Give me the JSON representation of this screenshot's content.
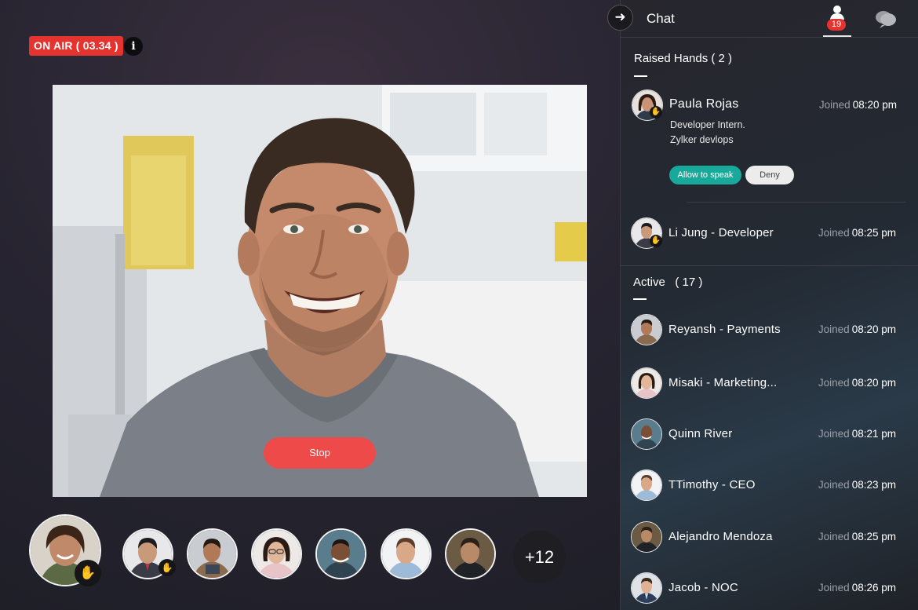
{
  "stage": {
    "on_air_label": "ON AIR ( 03.34 )",
    "info_label": "i",
    "stop_label": "Stop",
    "more_participants": "+12"
  },
  "panel": {
    "title": "Chat",
    "people_count": "19",
    "raised_hands": {
      "title": "Raised Hands ( 2 )",
      "people": [
        {
          "name": "Paula Rojas",
          "joined_label": "Joined",
          "joined_time": "08:20 pm",
          "role": "Developer Intern.",
          "company": "Zylker devlops",
          "allow_label": "Allow to speak",
          "deny_label": "Deny"
        },
        {
          "name": "Li Jung - Developer",
          "joined_label": "Joined",
          "joined_time": "08:25 pm"
        }
      ]
    },
    "active": {
      "title": "Active",
      "count": "( 17 )",
      "people": [
        {
          "name": "Reyansh - Payments",
          "joined_label": "Joined",
          "joined_time": "08:20 pm"
        },
        {
          "name": "Misaki - Marketing...",
          "joined_label": "Joined",
          "joined_time": "08:20 pm"
        },
        {
          "name": "Quinn River",
          "joined_label": "Joined",
          "joined_time": "08:21 pm"
        },
        {
          "name": "TTimothy - CEO",
          "joined_label": "Joined",
          "joined_time": "08:23 pm"
        },
        {
          "name": "Alejandro Mendoza",
          "joined_label": "Joined",
          "joined_time": "08:25 pm"
        },
        {
          "name": "Jacob - NOC",
          "joined_label": "Joined",
          "joined_time": "08:26 pm"
        }
      ]
    }
  },
  "colors": {
    "on_air": "#e5332f",
    "stop": "#ee4a4a",
    "allow": "#18a99a",
    "badge": "#e5332f",
    "hand": "#f4c23c"
  },
  "icons": {
    "info": "info-icon",
    "collapse": "arrow-right-icon",
    "people_tab": "person-icon",
    "chat_tab": "chat-bubbles-icon",
    "raised_hand": "raised-hand-icon"
  }
}
